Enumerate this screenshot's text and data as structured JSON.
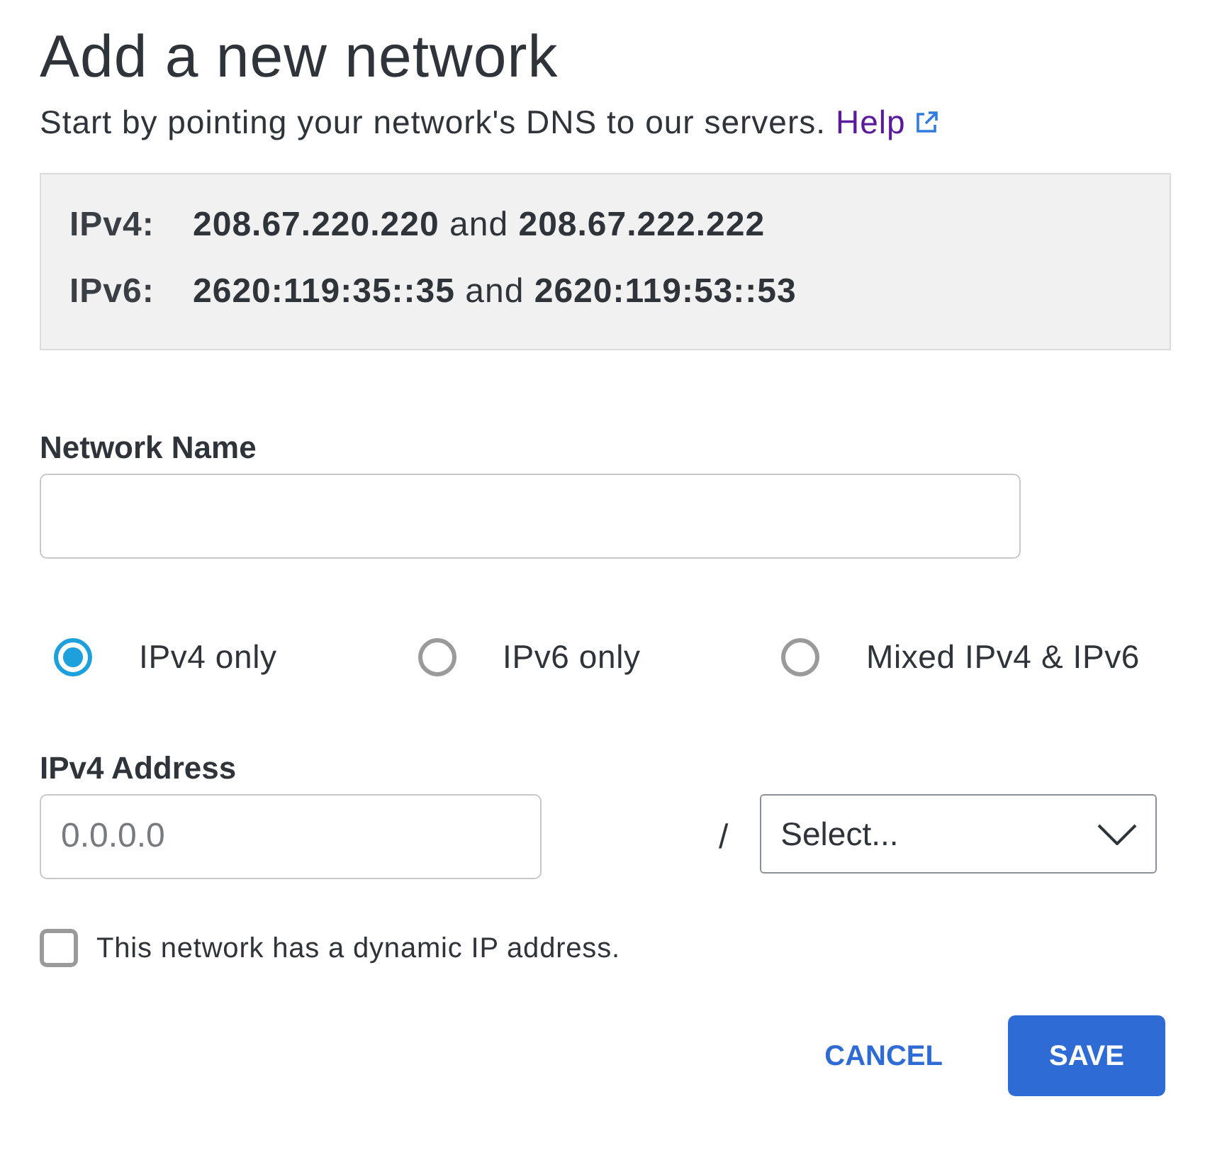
{
  "title": "Add a new network",
  "intro": {
    "text": "Start by pointing your network's DNS to our servers.",
    "link": "Help"
  },
  "dns_servers": [
    {
      "label": "IPv4:",
      "value": "**208.67.220.220** and **208.67.222.222**"
    },
    {
      "label": "IPv6:",
      "value": "**2620:119:35::35** and **2620:119:53::53**"
    }
  ],
  "network_name": {
    "label": "Network Name"
  },
  "ip_versions": [
    {
      "label": "IPv4 only",
      "selected": true
    },
    {
      "label": "IPv6 only",
      "selected": false
    },
    {
      "label": "Mixed IPv4 & IPv6",
      "selected": false
    }
  ],
  "address": {
    "label": "IPv4 Address",
    "placeholder": "0.0.0.0",
    "separator": "/",
    "select": {
      "value": "Select..."
    }
  },
  "dynamic_ip": {
    "label": "This network has a dynamic IP address.",
    "checked": false
  },
  "buttons": [
    {
      "label": "CANCEL",
      "kind": "text"
    },
    {
      "label": "SAVE",
      "kind": "primary"
    }
  ]
}
